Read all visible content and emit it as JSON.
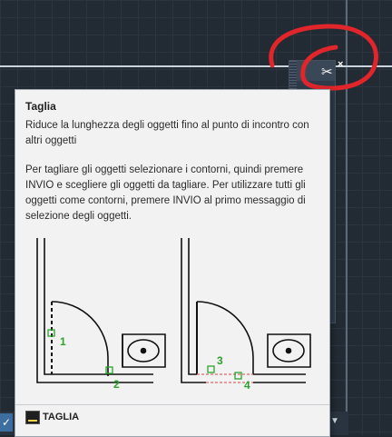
{
  "tooltip": {
    "title": "Taglia",
    "description": "Riduce la lunghezza degli oggetti fino al punto di incontro con altri oggetti",
    "body": "Per tagliare gli oggetti selezionare i contorni, quindi premere INVIO e scegliere gli oggetti da tagliare. Per utilizzare tutti gli oggetti come contorni, premere INVIO al primo messaggio di selezione degli oggetti.",
    "illustration": {
      "left_labels": [
        "1",
        "2"
      ],
      "right_labels": [
        "3",
        "4"
      ],
      "marker_color": "#2ea12e",
      "cut_color": "#e06a6a"
    },
    "command_name": "TAGLIA"
  },
  "palette": {
    "close_label": "×"
  },
  "colors": {
    "annotation_red": "#e0262b",
    "palette_bg": "#2f3b4a",
    "canvas_bg": "#222a33"
  }
}
